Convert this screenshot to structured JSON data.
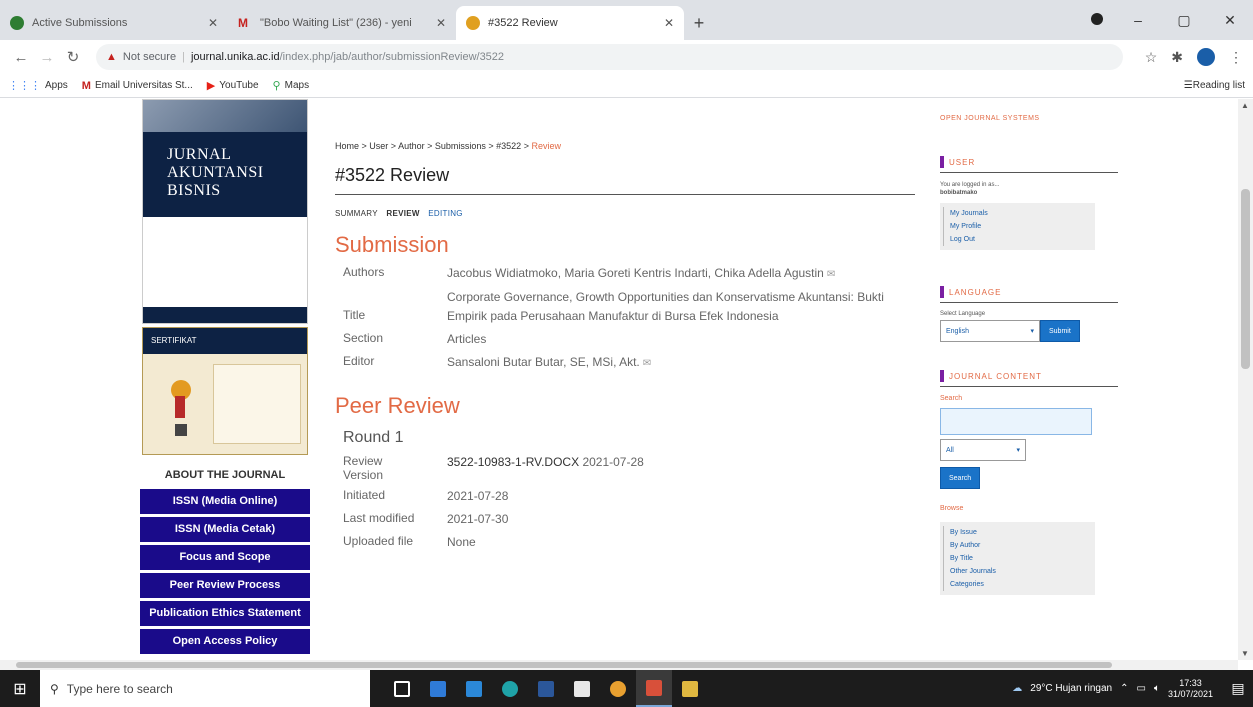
{
  "browser": {
    "tabs": [
      {
        "title": "Active Submissions",
        "icon_color": "#2e7d32",
        "active": false
      },
      {
        "title": "\"Bobo Waiting List\" (236) - yeni",
        "icon_color": "#c5221f",
        "active": false
      },
      {
        "title": "#3522 Review",
        "icon_color": "#e0a020",
        "active": true
      }
    ],
    "new_tab": "+",
    "window_controls": [
      "–",
      "▢",
      "✕"
    ],
    "address": {
      "not_secure": "Not secure",
      "host": "journal.unika.ac.id",
      "path": "/index.php/jab/author/submissionReview/3522"
    },
    "bookmarks": [
      {
        "label": "Apps",
        "icon": "apps-grid-icon"
      },
      {
        "label": "Email Universitas St...",
        "icon": "gmail-icon"
      },
      {
        "label": "YouTube",
        "icon": "youtube-icon"
      },
      {
        "label": "Maps",
        "icon": "maps-icon"
      }
    ],
    "reading_list": "Reading list"
  },
  "left_sidebar": {
    "cover_title_lines": [
      "JURNAL",
      "AKUNTANSI",
      "BISNIS"
    ],
    "certificate_label": "SERTIFIKAT",
    "about_title": "ABOUT THE JOURNAL",
    "menu": [
      "ISSN (Media Online)",
      "ISSN (Media Cetak)",
      "Focus and Scope",
      "Peer Review Process",
      "Publication Ethics Statement",
      "Open Access Policy"
    ]
  },
  "main": {
    "breadcrumb": [
      "Home",
      "User",
      "Author",
      "Submissions",
      "#3522",
      "Review"
    ],
    "breadcrumb_sep": " > ",
    "title": "#3522 Review",
    "subnav": [
      "SUMMARY",
      "REVIEW",
      "EDITING"
    ],
    "submission": {
      "heading": "Submission",
      "authors_label": "Authors",
      "authors_value": "Jacobus Widiatmoko, Maria Goreti Kentris Indarti, Chika Adella Agustin",
      "title_label": "Title",
      "title_value": "Corporate Governance, Growth Opportunities dan Konservatisme Akuntansi: Bukti Empirik pada Perusahaan Manufaktur di Bursa Efek Indonesia",
      "section_label": "Section",
      "section_value": "Articles",
      "editor_label": "Editor",
      "editor_value": "Sansaloni Butar Butar, SE, MSi, Akt."
    },
    "peer_review": {
      "heading": "Peer Review",
      "round": "Round 1",
      "review_version_label": "Review Version",
      "review_version_file": "3522-10983-1-RV.DOCX",
      "review_version_date": "2021-07-28",
      "initiated_label": "Initiated",
      "initiated_value": "2021-07-28",
      "last_modified_label": "Last modified",
      "last_modified_value": "2021-07-30",
      "uploaded_label": "Uploaded file",
      "uploaded_value": "None"
    }
  },
  "right_sidebar": {
    "ojs": "OPEN JOURNAL SYSTEMS",
    "user_title": "USER",
    "logged_in_text": "You are logged in as...",
    "username": "bobibatmako",
    "user_links": [
      "My Journals",
      "My Profile",
      "Log Out"
    ],
    "language_title": "LANGUAGE",
    "select_language": "Select Language",
    "language_value": "English",
    "submit_label": "Submit",
    "journal_content_title": "JOURNAL CONTENT",
    "search_label": "Search",
    "search_scope": "All",
    "search_button": "Search",
    "browse_label": "Browse",
    "browse_links": [
      "By Issue",
      "By Author",
      "By Title",
      "Other Journals",
      "Categories"
    ]
  },
  "taskbar": {
    "search_placeholder": "Type here to search",
    "apps": [
      {
        "name": "task-view",
        "color": "#ffffff"
      },
      {
        "name": "file-explorer",
        "color": "#2f7bd8"
      },
      {
        "name": "mail",
        "color": "#2b88d8"
      },
      {
        "name": "edge",
        "color": "#1fa3a8"
      },
      {
        "name": "word",
        "color": "#2b579a"
      },
      {
        "name": "store",
        "color": "#e8e8e8"
      },
      {
        "name": "chrome",
        "color": "#e8a030"
      },
      {
        "name": "ms-teams",
        "color": "#d8503a"
      },
      {
        "name": "file-manager",
        "color": "#e0b840"
      }
    ],
    "weather": "29°C Hujan ringan",
    "time": "17:33",
    "date": "31/07/2021"
  }
}
